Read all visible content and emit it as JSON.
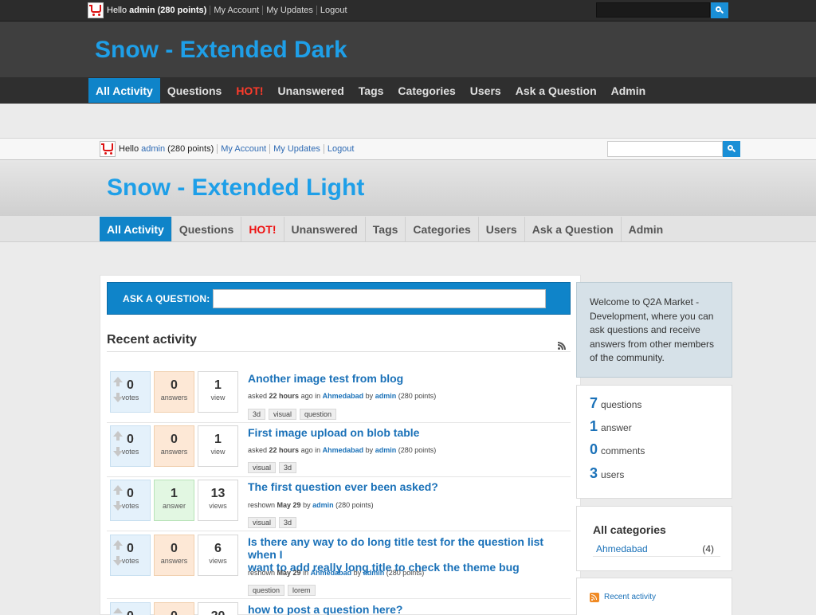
{
  "dark": {
    "userbar": {
      "hello": "Hello",
      "username": "admin",
      "points": "(280 points)",
      "links": [
        "My Account",
        "My Updates",
        "Logout"
      ]
    },
    "site_title": "Snow - Extended Dark",
    "nav": [
      "All Activity",
      "Questions",
      "HOT!",
      "Unanswered",
      "Tags",
      "Categories",
      "Users",
      "Ask a Question",
      "Admin"
    ]
  },
  "light": {
    "userbar": {
      "hello": "Hello",
      "username": "admin",
      "points": "(280 points)",
      "links": [
        "My Account",
        "My Updates",
        "Logout"
      ]
    },
    "site_title": "Snow - Extended Light",
    "nav": [
      "All Activity",
      "Questions",
      "HOT!",
      "Unanswered",
      "Tags",
      "Categories",
      "Users",
      "Ask a Question",
      "Admin"
    ]
  },
  "ask": {
    "label": "ASK A QUESTION:",
    "input_value": ""
  },
  "recent": {
    "title": "Recent activity",
    "items": [
      {
        "votes": "0",
        "votes_label": "votes",
        "answers": "0",
        "answers_label": "answers",
        "views": "1",
        "views_label": "view",
        "title": "Another image test from blog",
        "action": "asked",
        "when": "22 hours",
        "ago": "ago in",
        "where": "Ahmedabad",
        "by": "by",
        "who": "admin",
        "pts": "(280 points)",
        "tags": [
          "3d",
          "visual",
          "question"
        ]
      },
      {
        "votes": "0",
        "votes_label": "votes",
        "answers": "0",
        "answers_label": "answers",
        "views": "1",
        "views_label": "view",
        "title": "First image upload on blob table",
        "action": "asked",
        "when": "22 hours",
        "ago": "ago in",
        "where": "Ahmedabad",
        "by": "by",
        "who": "admin",
        "pts": "(280 points)",
        "tags": [
          "visual",
          "3d"
        ]
      },
      {
        "votes": "0",
        "votes_label": "votes",
        "answers": "1",
        "answers_label": "answer",
        "views": "13",
        "views_label": "views",
        "title": "The first question ever been asked?",
        "action": "reshown",
        "when": "May 29",
        "by": "by",
        "who": "admin",
        "pts": "(280 points)",
        "tags": [
          "visual",
          "3d"
        ]
      },
      {
        "votes": "0",
        "votes_label": "votes",
        "answers": "0",
        "answers_label": "answers",
        "views": "6",
        "views_label": "views",
        "title_line1": "Is there any way to do long title test for the question list when I",
        "title_line2": "want to add really long title to check the theme bug",
        "action": "reshown",
        "when": "May 29",
        "ago": "in",
        "where": "Ahmedabad",
        "by": "by",
        "who": "admin",
        "pts": "(280 points)",
        "tags": [
          "question",
          "lorem"
        ]
      },
      {
        "votes": "0",
        "answers": "0",
        "views": "20",
        "title": "how to post a question here?"
      }
    ]
  },
  "sidebar": {
    "welcome": "Welcome to Q2A Market - Development, where you can ask questions and receive answers from other members of the community.",
    "stats": [
      {
        "n": "7",
        "label": "questions"
      },
      {
        "n": "1",
        "label": "answer"
      },
      {
        "n": "0",
        "label": "comments"
      },
      {
        "n": "3",
        "label": "users"
      }
    ],
    "categories_title": "All categories",
    "categories": [
      {
        "name": "Ahmedabad",
        "count": "(4)"
      }
    ],
    "feed_link": "Recent activity"
  },
  "colors": {
    "accent": "#0f84c9",
    "title_blue": "#1e9fe8",
    "link_blue": "#1a71b8",
    "hot_red": "#ff3b2b"
  }
}
